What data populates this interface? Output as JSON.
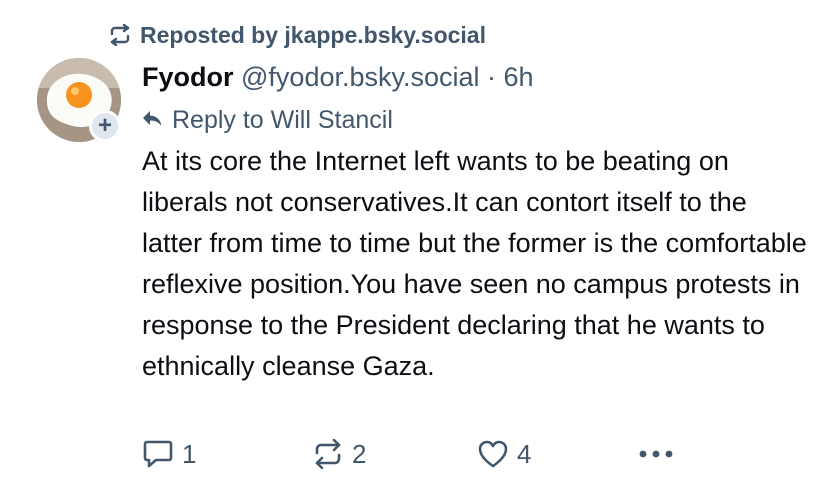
{
  "repost": {
    "label": "Reposted by jkappe.bsky.social",
    "icon": "repost-icon"
  },
  "post": {
    "author_name": "Fyodor",
    "author_handle": "@fyodor.bsky.social",
    "separator": " · ",
    "time": "6h",
    "reply_to": "Reply to Will Stancil",
    "text": "At its core the Internet left wants to be beating on liberals not conservatives.It can contort itself to the latter from time to time but the former is the comfortable reflexive position.You have seen no campus protests in response to the President declaring that he wants to ethnically cleanse Gaza.",
    "avatar_plus": "+"
  },
  "actions": {
    "reply_count": "1",
    "repost_count": "2",
    "like_count": "4"
  },
  "colors": {
    "muted": "#42576c",
    "text": "#0b0f14",
    "background": "#ffffff"
  }
}
